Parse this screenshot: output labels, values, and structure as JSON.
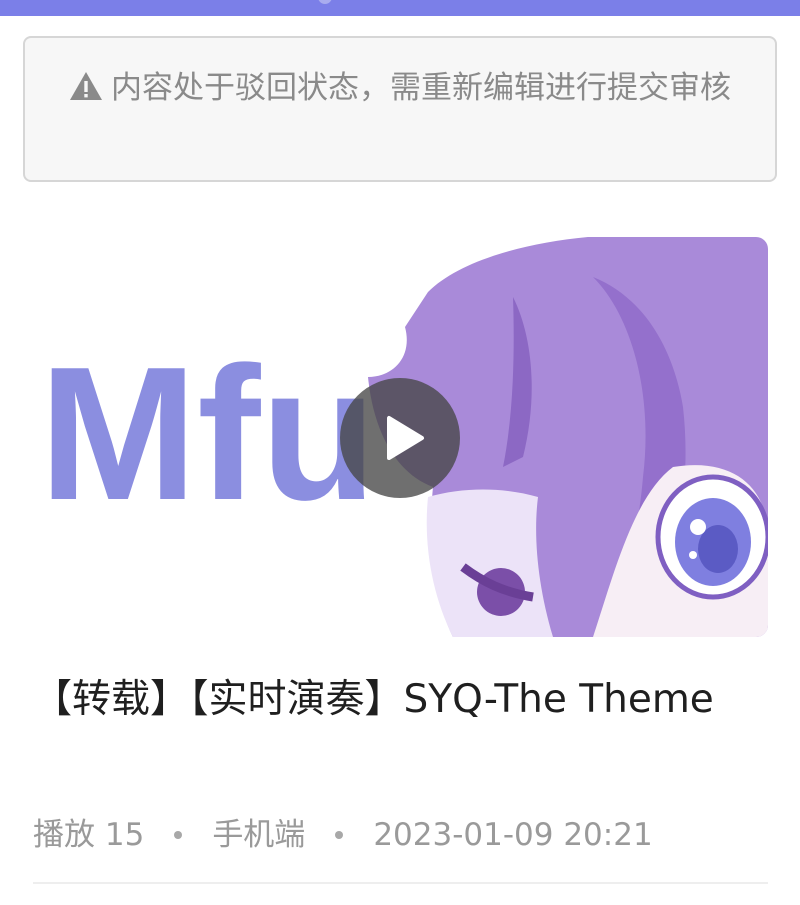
{
  "status_bar": {
    "color": "#7b7fe8"
  },
  "alert": {
    "icon": "warning-triangle-icon",
    "text": "内容处于驳回状态，需重新编辑进行提交审核"
  },
  "video": {
    "thumbnail_text": "Mfu",
    "play_icon": "play-icon",
    "title": "【转载】【实时演奏】SYQ-The Theme",
    "views_label": "播放",
    "views": "15",
    "source": "手机端",
    "datetime": "2023-01-09 20:21"
  },
  "colors": {
    "alert_text": "#8a8a8a",
    "thumbnail_logo": "#8b8ee0",
    "character_hair": "#a98ad9"
  }
}
